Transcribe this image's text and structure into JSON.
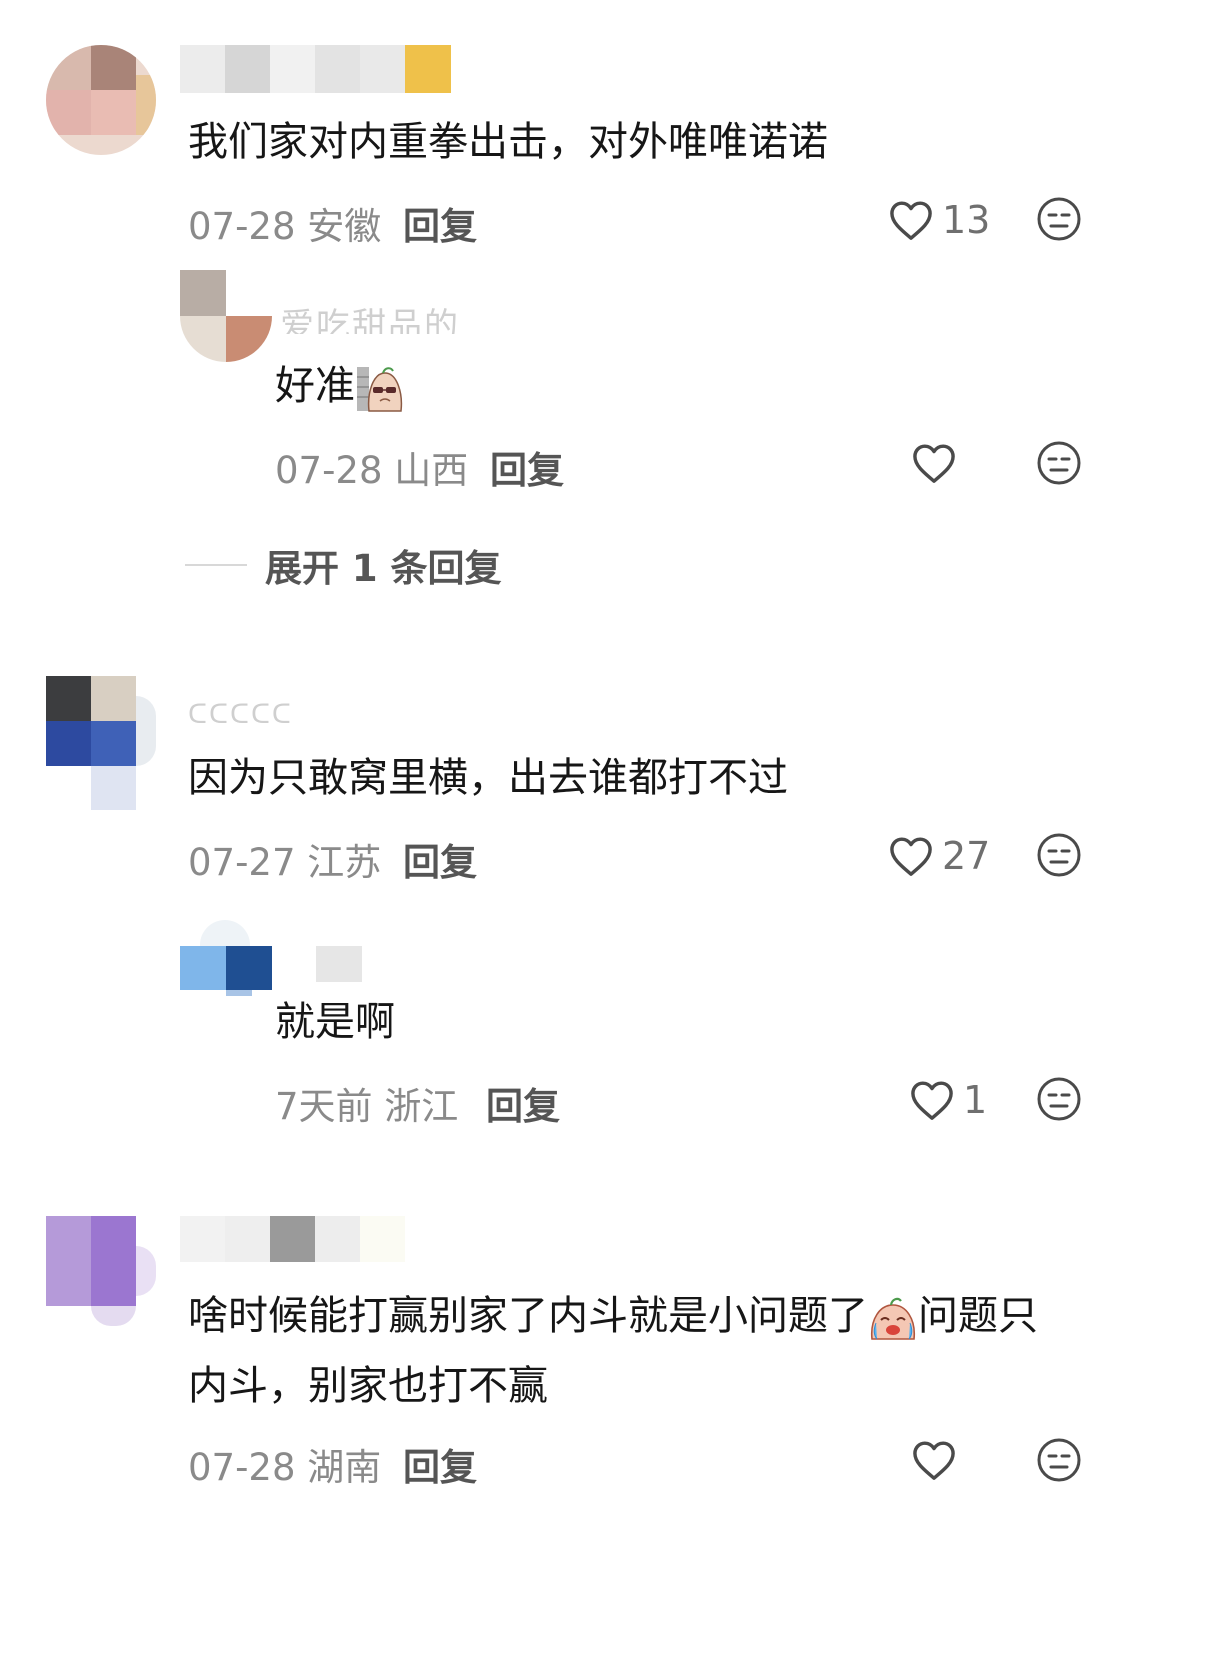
{
  "comments": [
    {
      "text": "我们家对内重拳出击，对外唯唯诺诺",
      "date": "07-28",
      "location": "安徽",
      "reply_label": "回复",
      "likes": "13"
    },
    {
      "name": "爱吃甜品的",
      "text": "好准",
      "date": "07-28",
      "location": "山西",
      "reply_label": "回复",
      "likes": ""
    },
    {
      "expand_label": "展开 1 条回复"
    },
    {
      "name": "ᑕᑕᑕᑕᑕ",
      "text": "因为只敢窝里横，出去谁都打不过",
      "date": "07-27",
      "location": "江苏",
      "reply_label": "回复",
      "likes": "27"
    },
    {
      "text": "就是啊",
      "date": "7天前",
      "location": "浙江",
      "reply_label": "回复",
      "likes": "1"
    },
    {
      "text_line1": "啥时候能打赢别家了内斗就是小问题了",
      "text_line1b": "问题只",
      "text_line2": "内斗，别家也打不赢",
      "date": "07-28",
      "location": "湖南",
      "reply_label": "回复",
      "likes": ""
    }
  ],
  "icons": {
    "like": "heart-outline-icon",
    "dislike": "meh-face-icon",
    "emoji_wall": "peeking-wall-emoji",
    "emoji_cry": "crying-laughing-emoji"
  },
  "colors": {
    "meta_gray": "#8a8a8a",
    "reply_gray": "#555555",
    "text": "#161616"
  }
}
